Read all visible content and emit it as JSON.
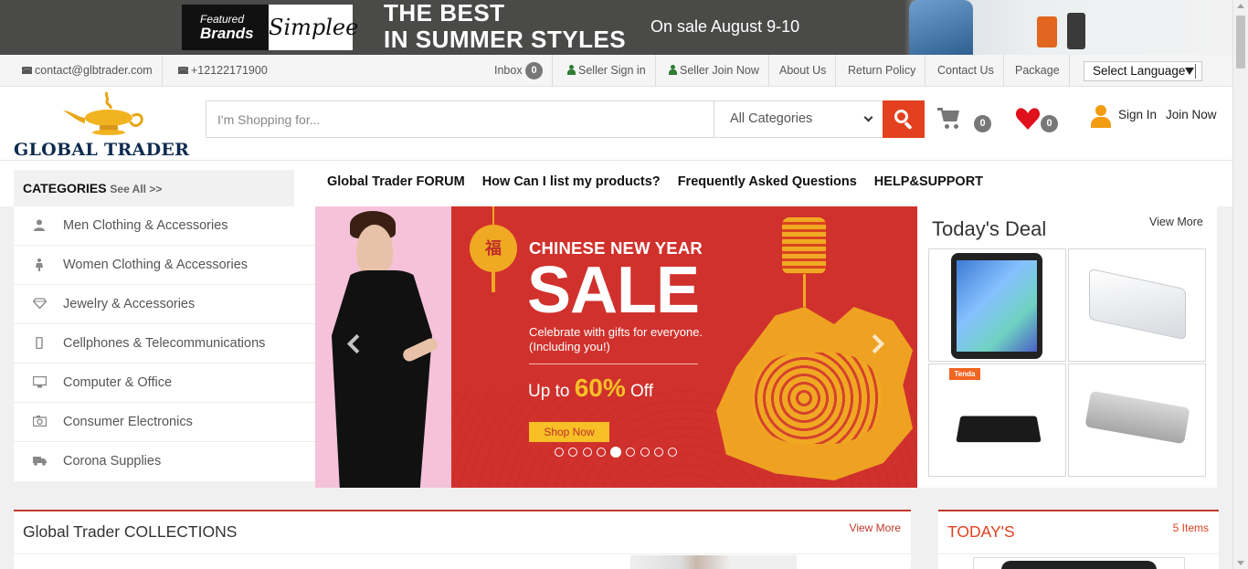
{
  "banner": {
    "featured": "Featured",
    "brands": "Brands",
    "brand_name": "Simplee",
    "headline_line1": "THE BEST",
    "headline_line2": "IN SUMMER STYLES",
    "sale_text": "On sale August 9-10"
  },
  "topbar": {
    "email": "contact@glbtrader.com",
    "phone": "+12122171900",
    "inbox_label": "Inbox",
    "inbox_count": "0",
    "seller_signin": "Seller Sign in",
    "seller_join": "Seller Join Now",
    "about": "About Us",
    "return_policy": "Return Policy",
    "contact": "Contact Us",
    "package": "Package",
    "language": "Select Language"
  },
  "header": {
    "logo_text": "GLOBAL TRADER",
    "search_placeholder": "I'm Shopping for...",
    "category_selected": "All Categories",
    "cart_count": "0",
    "wishlist_count": "0",
    "sign_in": "Sign In",
    "join_now": "Join Now"
  },
  "nav": {
    "categories_label": "CATEGORIES",
    "see_all": "See All >>",
    "links": [
      "Global Trader FORUM",
      "How Can I list my products?",
      "Frequently Asked Questions",
      "HELP&SUPPORT"
    ]
  },
  "sidebar": {
    "items": [
      {
        "label": "Men Clothing & Accessories",
        "icon": "user-icon"
      },
      {
        "label": "Women Clothing & Accessories",
        "icon": "female-icon"
      },
      {
        "label": "Jewelry & Accessories",
        "icon": "diamond-icon"
      },
      {
        "label": "Cellphones & Telecommunications",
        "icon": "mobile-icon"
      },
      {
        "label": "Computer & Office",
        "icon": "desktop-icon"
      },
      {
        "label": "Consumer Electronics",
        "icon": "camera-icon"
      },
      {
        "label": "Corona Supplies",
        "icon": "truck-icon"
      }
    ]
  },
  "carousel": {
    "lantern_char": "福",
    "title": "CHINESE NEW YEAR",
    "sale": "SALE",
    "subtitle": "Celebrate with gifts for everyone. (Including you!)",
    "up_to": "Up to",
    "percent": "60%",
    "off": "Off",
    "button": "Shop Now",
    "slide_count": 9,
    "active_slide": 5
  },
  "deal": {
    "title": "Today's Deal",
    "view_more": "View More",
    "items": [
      {
        "name": "tablet-product"
      },
      {
        "name": "network-switch-product"
      },
      {
        "name": "router-product",
        "brand_tag": "Tenda"
      },
      {
        "name": "speaker-product"
      }
    ]
  },
  "collections": {
    "title": "Global Trader COLLECTIONS",
    "view_more": "View More"
  },
  "today": {
    "title": "TODAY'S",
    "count": "5 Items"
  },
  "colors": {
    "accent": "#e2401f",
    "brand_navy": "#0e2b4f",
    "banner_red": "#d0312d",
    "gold": "#f6c026"
  }
}
